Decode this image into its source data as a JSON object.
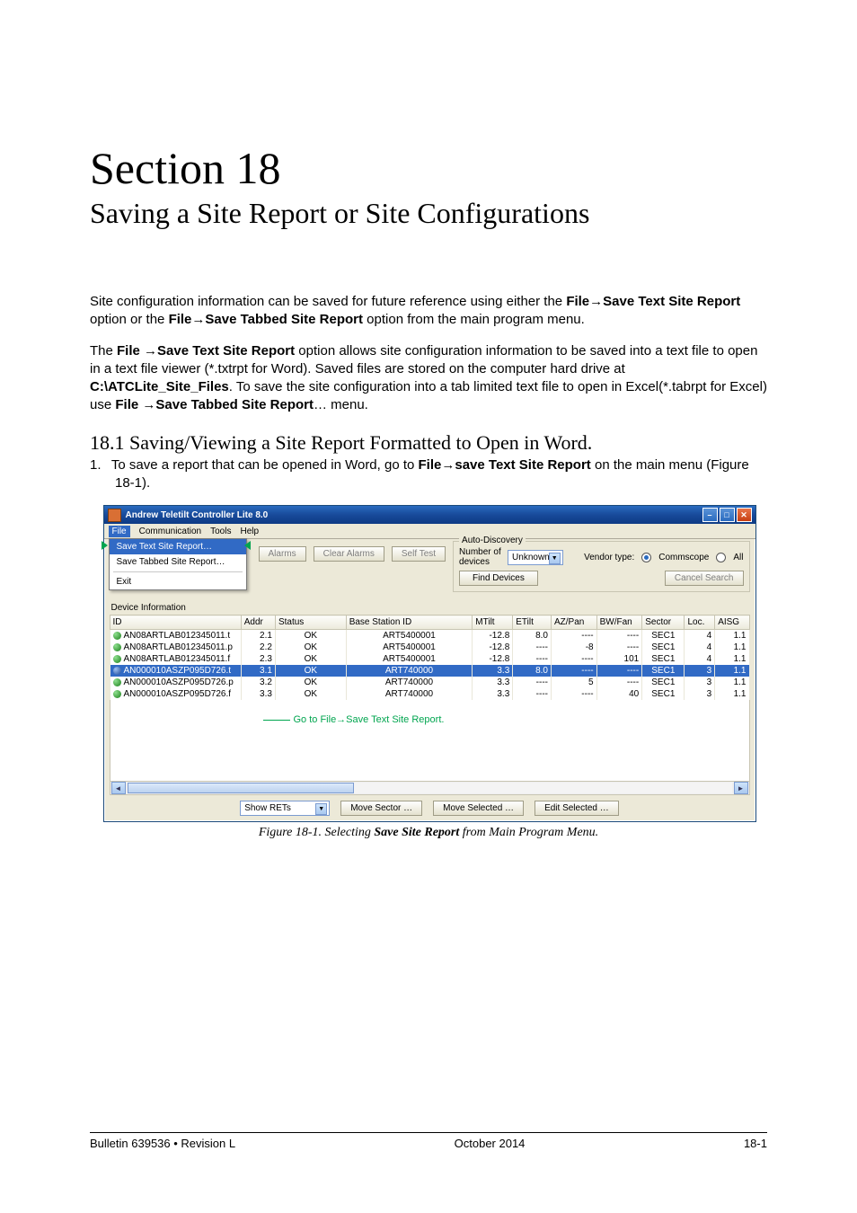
{
  "doc": {
    "section_number": "Section 18",
    "section_title": "Saving a Site Report or Site Configurations",
    "para1_pre": "Site configuration information can be saved for future reference using either the ",
    "para1_b1": "File",
    "para1_arrow1": "→",
    "para1_b2": "Save Text Site Report",
    "para1_mid": " option or the ",
    "para1_b3": "File",
    "para1_arrow2": "→",
    "para1_b4": "Save Tabbed Site Report",
    "para1_post": " option from the main program menu.",
    "para2_pre": "The ",
    "para2_b1": "File ",
    "para2_arrow1": "→",
    "para2_b2": "Save Text Site Report",
    "para2_mid1": " option allows site configuration information to be saved into a text file to open in a text file viewer (*.txtrpt for Word). Saved files are stored on the computer hard drive at ",
    "para2_b3": "C:\\ATCLite_Site_Files",
    "para2_mid2": ". To save the site configuration into a tab limited text file to open in Excel(*.tabrpt for Excel) use ",
    "para2_b4": "File ",
    "para2_arrow2": "→",
    "para2_b5": "Save Tabbed Site Report",
    "para2_post": "… menu.",
    "subhead": "18.1 Saving/Viewing a Site Report Formatted to Open in Word.",
    "step1_num": "1.",
    "step1_pre": "To save a report that can be opened in Word, go to ",
    "step1_b1": "File",
    "step1_arrow": "→",
    "step1_b2": "save Text Site Report",
    "step1_post": " on the main menu (Figure 18-1).",
    "figure_caption_pre": "Figure 18-1. Selecting ",
    "figure_caption_b": "Save Site Report",
    "figure_caption_post": " from Main Program Menu."
  },
  "app": {
    "title": "Andrew Teletilt Controller Lite 8.0",
    "menus": [
      "File",
      "Communication",
      "Tools",
      "Help"
    ],
    "file_menu": {
      "items": [
        "Save Text Site Report…",
        "Save Tabbed Site Report…",
        "Exit"
      ]
    },
    "buttons": {
      "alarms": "Alarms",
      "clear_alarms": "Clear Alarms",
      "self_test": "Self Test",
      "find_devices": "Find Devices",
      "cancel_search": "Cancel Search",
      "move_sector": "Move Sector …",
      "move_selected": "Move Selected …",
      "edit_selected": "Edit Selected …"
    },
    "auto_discovery": {
      "legend": "Auto-Discovery",
      "num_devices_label": "Number of\ndevices",
      "num_devices_value": "Unknown",
      "vendor_type_label": "Vendor type:",
      "vendor_opt1": "Commscope",
      "vendor_opt2": "All"
    },
    "show_select": "Show RETs",
    "dev_info_label": "Device Information",
    "annotation": "Go to File→Save Text Site Report.",
    "columns": [
      "ID",
      "Addr",
      "Status",
      "Base Station ID",
      "MTilt",
      "ETilt",
      "AZ/Pan",
      "BW/Fan",
      "Sector",
      "Loc.",
      "AISG"
    ],
    "rows": [
      {
        "dot": "green",
        "id": "AN08ARTLAB012345011.t",
        "addr": "2.1",
        "status": "OK",
        "bsid": "ART5400001",
        "mtilt": "-12.8",
        "etilt": "8.0",
        "azpan": "----",
        "bwfan": "----",
        "sector": "SEC1",
        "loc": "4",
        "aisg": "1.1",
        "sel": false
      },
      {
        "dot": "green",
        "id": "AN08ARTLAB012345011.p",
        "addr": "2.2",
        "status": "OK",
        "bsid": "ART5400001",
        "mtilt": "-12.8",
        "etilt": "----",
        "azpan": "-8",
        "bwfan": "----",
        "sector": "SEC1",
        "loc": "4",
        "aisg": "1.1",
        "sel": false
      },
      {
        "dot": "green",
        "id": "AN08ARTLAB012345011.f",
        "addr": "2.3",
        "status": "OK",
        "bsid": "ART5400001",
        "mtilt": "-12.8",
        "etilt": "----",
        "azpan": "----",
        "bwfan": "101",
        "sector": "SEC1",
        "loc": "4",
        "aisg": "1.1",
        "sel": false
      },
      {
        "dot": "blue",
        "id": "AN000010ASZP095D726.t",
        "addr": "3.1",
        "status": "OK",
        "bsid": "ART740000",
        "mtilt": "3.3",
        "etilt": "8.0",
        "azpan": "----",
        "bwfan": "----",
        "sector": "SEC1",
        "loc": "3",
        "aisg": "1.1",
        "sel": true
      },
      {
        "dot": "green",
        "id": "AN000010ASZP095D726.p",
        "addr": "3.2",
        "status": "OK",
        "bsid": "ART740000",
        "mtilt": "3.3",
        "etilt": "----",
        "azpan": "5",
        "bwfan": "----",
        "sector": "SEC1",
        "loc": "3",
        "aisg": "1.1",
        "sel": false
      },
      {
        "dot": "green",
        "id": "AN000010ASZP095D726.f",
        "addr": "3.3",
        "status": "OK",
        "bsid": "ART740000",
        "mtilt": "3.3",
        "etilt": "----",
        "azpan": "----",
        "bwfan": "40",
        "sector": "SEC1",
        "loc": "3",
        "aisg": "1.1",
        "sel": false
      }
    ]
  },
  "footer": {
    "left": "Bulletin 639536  •  Revision L",
    "center": "October 2014",
    "right": "18-1"
  }
}
